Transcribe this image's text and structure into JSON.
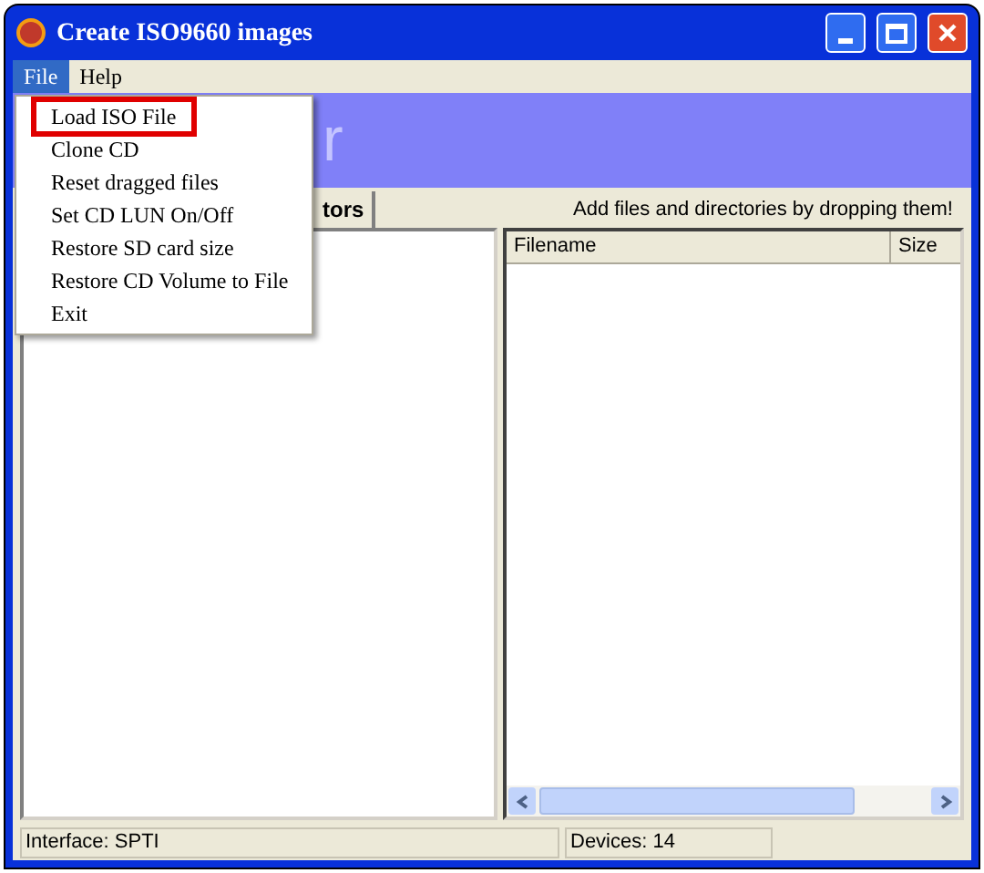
{
  "window": {
    "title": "Create ISO9660 images"
  },
  "menu_bar": [
    {
      "label": "File",
      "selected": true
    },
    {
      "label": "Help",
      "selected": false
    }
  ],
  "file_menu": [
    {
      "label": "Load ISO File",
      "selected": true
    },
    {
      "label": "Clone CD",
      "selected": false
    },
    {
      "label": "Reset dragged files",
      "selected": false
    },
    {
      "label": "Set CD LUN On/Off",
      "selected": false
    },
    {
      "label": "Restore SD card size",
      "selected": false
    },
    {
      "label": "Restore CD Volume to File",
      "selected": false
    },
    {
      "label": "Exit",
      "selected": false
    }
  ],
  "banner": {
    "text": "r"
  },
  "tabs": [
    {
      "label": "tors",
      "selected": true
    }
  ],
  "hint": "Add files and directories by dropping them!",
  "file_list": {
    "columns": [
      "Filename",
      "Size"
    ]
  },
  "status_bar": [
    "Interface: SPTI",
    "Devices: 14"
  ]
}
